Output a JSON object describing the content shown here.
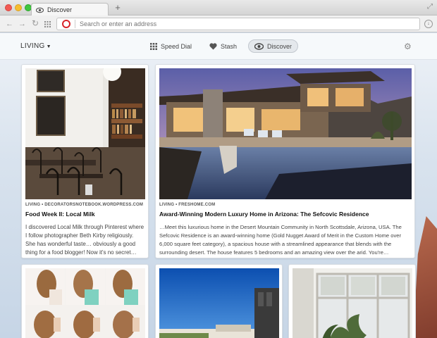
{
  "window": {
    "tab_title": "Discover",
    "new_tab_symbol": "+"
  },
  "toolbar": {
    "back_symbol": "←",
    "forward_symbol": "→",
    "reload_symbol": "↻",
    "address_placeholder": "Search or enter an address"
  },
  "header": {
    "category": "LIVING",
    "nav": [
      {
        "label": "Speed Dial",
        "icon": "grid-icon"
      },
      {
        "label": "Stash",
        "icon": "heart-icon"
      },
      {
        "label": "Discover",
        "icon": "eye-icon",
        "active": true
      }
    ]
  },
  "cards": [
    {
      "source": "LIVING • DECORATORSNOTEBOOK.WORDPRESS.COM",
      "title": "Food Week II: Local Milk",
      "excerpt_lines": [
        "I discovered Local Milk through Pinterest where",
        "I follow photographer Beth Kirby religiously.",
        "She has wonderful taste… obviously a good",
        "thing for a food blogger! Now it's no secret…"
      ]
    },
    {
      "source": "LIVING • FRESHOME.COM",
      "title": "Award-Winning Modern Luxury Home in Arizona: The Sefcovic Residence",
      "excerpt_lines": [
        "…Meet this luxurious home in the Desert Mountain Community in North Scottsdale, Arizona, USA. The",
        "Sefcovic Residence is an award-winning home (Gold Nugget Award of Merit in the Custom Home over",
        "6,000 square feet category), a spacious house with a streamlined appearance that blends with the",
        "surrounding desert. The house features 5 bedrooms and an amazing view over the arid. You're…"
      ]
    }
  ],
  "colors": {
    "accent": "#d8232a",
    "active_pill": "#e4e8ec"
  }
}
